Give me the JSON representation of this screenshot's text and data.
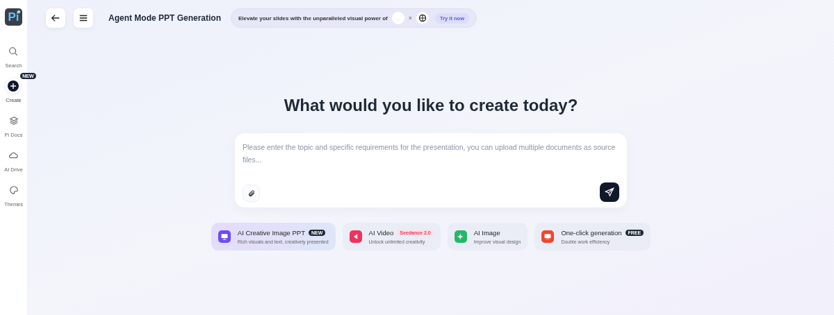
{
  "logo": {
    "text": "Pi"
  },
  "sidebar": {
    "items": [
      {
        "label": "Search",
        "kind": "search",
        "selected": false
      },
      {
        "label": "Create",
        "kind": "create",
        "selected": true,
        "badge": "NEW"
      },
      {
        "label": "Pi Docs",
        "kind": "docs",
        "selected": false
      },
      {
        "label": "AI Drive",
        "kind": "drive",
        "selected": false
      },
      {
        "label": "Themes",
        "kind": "themes",
        "selected": false
      }
    ]
  },
  "header": {
    "title": "Agent Mode PPT Generation",
    "promo": {
      "text": "Elevate your slides with the unparalleled visual power of",
      "separator": "×",
      "action": "Try it now"
    }
  },
  "heading": "What would you like to create today?",
  "prompt": {
    "placeholder": "Please enter the topic and specific requirements for the presentation, you can upload multiple documents as source files..."
  },
  "modes": [
    {
      "title": "AI Creative Image PPT",
      "subtitle": "Rich visuals and text, creatively presented",
      "badge": {
        "text": "NEW",
        "color": "#1f2937"
      },
      "kind": "ppt",
      "color": "#6d4cf5",
      "selected": true
    },
    {
      "title": "AI Video",
      "subtitle": "Unlock unlimited creativity",
      "badge": {
        "text": "Seedance 2.0",
        "color": "#fde0e6"
      },
      "kind": "video",
      "color": "#f0325e",
      "selected": false
    },
    {
      "title": "AI Image",
      "subtitle": "Improve visual design",
      "kind": "image",
      "color": "#22b86a",
      "selected": false
    },
    {
      "title": "One-click generation",
      "subtitle": "Double work efficiency",
      "badge": {
        "text": "FREE",
        "color": "#1f2937"
      },
      "kind": "oneclick",
      "color": "#f0452e",
      "selected": false
    }
  ]
}
